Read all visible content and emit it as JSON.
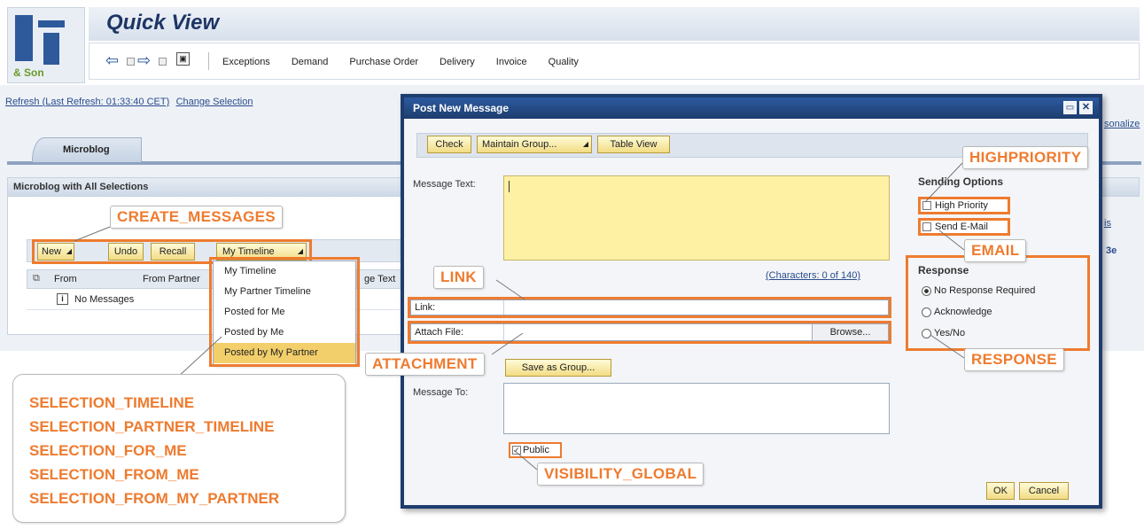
{
  "app": {
    "logo_text": "& Son",
    "title": "Quick View",
    "nav": [
      "Exceptions",
      "Demand",
      "Purchase Order",
      "Delivery",
      "Invoice",
      "Quality"
    ],
    "refresh_text": "Refresh (Last Refresh: 01:33:40 CET)",
    "change_selection": "Change Selection",
    "personalize_fragment": "sonalize",
    "tab_label": "Microblog",
    "panel_title": "Microblog with All Selections",
    "side_fragment_1": "is",
    "side_fragment_2": "3e"
  },
  "toolbar": {
    "new": "New",
    "undo": "Undo",
    "recall": "Recall",
    "my_timeline": "My Timeline"
  },
  "table": {
    "col_from": "From",
    "col_from_partner": "From Partner",
    "col_text_fragment": "ge Text",
    "empty": "No Messages"
  },
  "timeline_menu": [
    "My Timeline",
    "My Partner Timeline",
    "Posted for Me",
    "Posted by Me",
    "Posted by My Partner"
  ],
  "dialog": {
    "title": "Post New Message",
    "buttons": {
      "check": "Check",
      "maintain_group": "Maintain Group...",
      "table_view": "Table View"
    },
    "message_text_label": "Message Text:",
    "char_counter": "(Characters: 0 of 140)",
    "link_label": "Link:",
    "attach_label": "Attach File:",
    "browse": "Browse...",
    "save_as_group": "Save as Group...",
    "message_to_label": "Message To:",
    "public_label": "Public",
    "sending_options_title": "Sending Options",
    "high_priority": "High Priority",
    "send_email": "Send E-Mail",
    "response_title": "Response",
    "response_options": [
      "No Response Required",
      "Acknowledge",
      "Yes/No"
    ],
    "ok": "OK",
    "cancel": "Cancel"
  },
  "callouts": {
    "create_messages": "CREATE_MESSAGES",
    "link": "LINK",
    "attachment": "ATTACHMENT",
    "visibility_global": "VISIBILITY_GLOBAL",
    "highpriority": "HIGHPRIORITY",
    "email": "EMAIL",
    "response": "RESPONSE",
    "selection_list": [
      "SELECTION_TIMELINE",
      "SELECTION_PARTNER_TIMELINE",
      "SELECTION_FOR_ME",
      "SELECTION_FROM_ME",
      "SELECTION_FROM_MY_PARTNER"
    ]
  },
  "colors": {
    "accent": "#ee7b2f",
    "dialog_header": "#1e3d6e",
    "button_fill": "#f2dc84",
    "text_area_fill": "#fff1a3"
  }
}
